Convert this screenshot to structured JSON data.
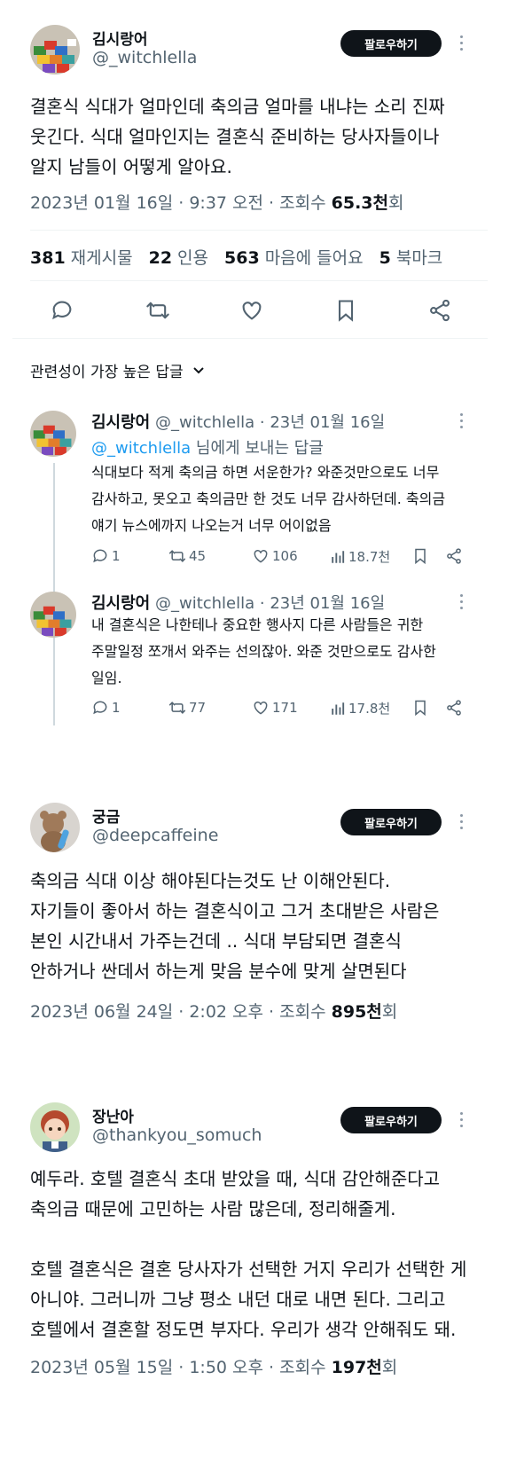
{
  "tweet1": {
    "name": "김시랑어",
    "handle": "@_witchlella",
    "follow_label": "팔로우하기",
    "body": "결혼식 식대가 얼마인데 축의금 얼마를 내냐는 소리 진짜\n웃긴다. 식대 얼마인지는 결혼식 준비하는 당사자들이나\n알지 남들이 어떻게 알아요.",
    "meta_prefix": "2023년 01월 16일 · 9:37 오전 · 조회수 ",
    "views": "65.3천",
    "views_suffix": "회",
    "stats": {
      "retweets": "381",
      "retweets_label": "재게시물",
      "quotes": "22",
      "quotes_label": "인용",
      "likes": "563",
      "likes_label": "마음에 들어요",
      "bookmarks": "5",
      "bookmarks_label": "북마크"
    },
    "sort_label": "관련성이 가장 높은 답글"
  },
  "replies": [
    {
      "name": "김시랑어",
      "rest": " @_witchlella · 23년 01월 16일",
      "to_handle": "@_witchlella",
      "to_suffix": " 님에게 보내는 답글",
      "text": "식대보다 적게 축의금 하면 서운한가? 와준것만으로도 너무\n감사하고, 못오고 축의금만 한 것도 너무 감사하던데. 축의금\n얘기 뉴스에까지 나오는거 너무 어이없음",
      "replies": "1",
      "retweets": "45",
      "likes": "106",
      "views": "18.7천"
    },
    {
      "name": "김시랑어",
      "rest": " @_witchlella · 23년 01월 16일",
      "text": "내 결혼식은 나한테나 중요한 행사지 다른 사람들은 귀한\n주말일정 쪼개서 와주는 선의잖아. 와준 것만으로도 감사한\n일임.",
      "replies": "1",
      "retweets": "77",
      "likes": "171",
      "views": "17.8천"
    }
  ],
  "tweet2": {
    "name": "궁금",
    "handle": "@deepcaffeine",
    "follow_label": "팔로우하기",
    "body": "축의금 식대 이상 해야된다는것도 난 이해안된다.\n자기들이 좋아서 하는 결혼식이고 그거 초대받은 사람은\n본인 시간내서 가주는건데 .. 식대 부담되면 결혼식\n안하거나 싼데서 하는게 맞음 분수에 맞게 살면된다",
    "meta_prefix": "2023년 06월 24일 · 2:02 오후 · 조회수 ",
    "views": "895천",
    "views_suffix": "회"
  },
  "tweet3": {
    "name": "장난아",
    "handle": "@thankyou_somuch",
    "follow_label": "팔로우하기",
    "body": "예두라. 호텔 결혼식 초대 받았을 때, 식대 감안해준다고\n축의금 때문에 고민하는 사람 많은데, 정리해줄게.\n\n호텔 결혼식은 결혼 당사자가 선택한 거지 우리가 선택한 게\n아니야. 그러니까 그냥 평소 내던 대로 내면 된다. 그리고\n호텔에서 결혼할 정도면 부자다. 우리가 생각 안해줘도 돼.",
    "meta_prefix": "2023년 05월 15일 · 1:50 오후 · 조회수 ",
    "views": "197천",
    "views_suffix": "회"
  }
}
